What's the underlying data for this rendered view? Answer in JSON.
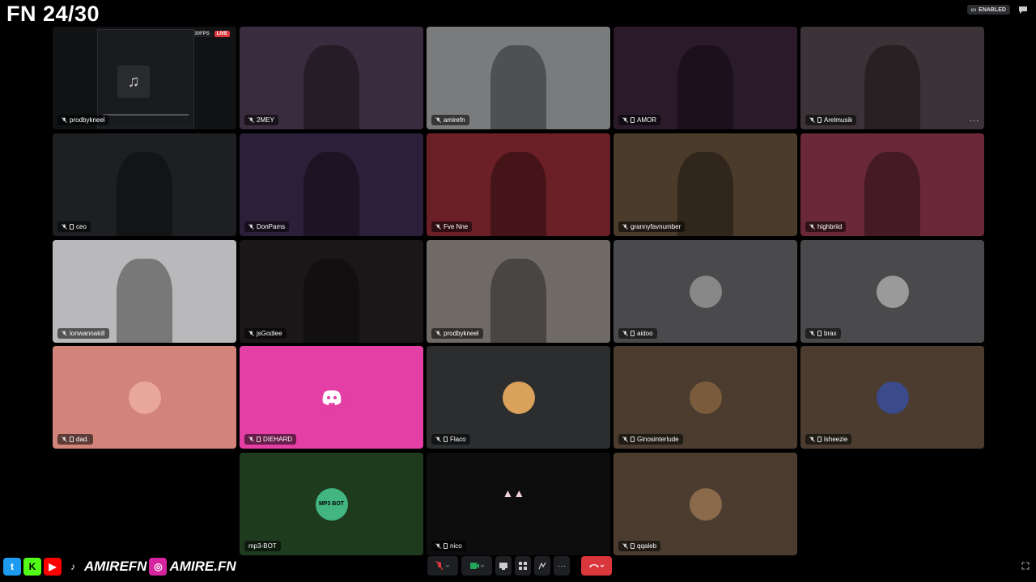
{
  "overlay": {
    "title": "FN 24/30"
  },
  "topbar": {
    "enabled_label": "ENABLED"
  },
  "stream": {
    "resolution": "720P 30FPS",
    "live": "LIVE"
  },
  "participants": [
    {
      "name": "prodbykneel",
      "kind": "stream",
      "bg": "#111214"
    },
    {
      "name": "2MEY",
      "kind": "video",
      "bg": "#3a2c3e"
    },
    {
      "name": "amirefn",
      "kind": "video",
      "bg": "#7a7b7d"
    },
    {
      "name": "AMOR",
      "kind": "video",
      "bg": "#2a1a2a"
    },
    {
      "name": "Arelmusik",
      "kind": "video",
      "bg": "#3c3338"
    },
    {
      "name": "ceo",
      "kind": "video",
      "bg": "#1e1f22"
    },
    {
      "name": "DonPams",
      "kind": "video",
      "bg": "#2b1f3a"
    },
    {
      "name": "Fve Nne",
      "kind": "video",
      "bg": "#6b1f26"
    },
    {
      "name": "grannyfavnumber",
      "kind": "video",
      "bg": "#4a3b2a"
    },
    {
      "name": "highbriid",
      "kind": "video",
      "bg": "#6a2838"
    },
    {
      "name": "lonwannakill",
      "kind": "video",
      "bg": "#b9b9bb"
    },
    {
      "name": "jsGodiee",
      "kind": "video",
      "bg": "#1b1718"
    },
    {
      "name": "prodbykneel",
      "kind": "video",
      "bg": "#6f6a66"
    },
    {
      "name": "aidoo",
      "kind": "avatar",
      "bg": "#4a4a4c",
      "avatar_color": "#888888"
    },
    {
      "name": "brax",
      "kind": "avatar",
      "bg": "#4a4a4c",
      "avatar_color": "#9a9a9a"
    },
    {
      "name": "dad.",
      "kind": "avatar",
      "bg": "#d2837a",
      "avatar_color": "#e9a79c"
    },
    {
      "name": "DIEHARD",
      "kind": "discord",
      "bg": "#e43fa4",
      "avatar_color": "#e43fa4"
    },
    {
      "name": "Flaco",
      "kind": "avatar",
      "bg": "#2c2d2f",
      "avatar_color": "#d9a15a"
    },
    {
      "name": "Ginosinterlude",
      "kind": "avatar",
      "bg": "#4b3c2f",
      "avatar_color": "#7a5c3c"
    },
    {
      "name": "lsheezie",
      "kind": "avatar",
      "bg": "#4b3c2f",
      "avatar_color": "#3b4a8a"
    },
    {
      "name": "mp3-BOT",
      "kind": "bot",
      "bg": "#1e3b1e",
      "avatar_color": "#43b581",
      "avatar_text": "MP3 BOT"
    },
    {
      "name": "nico",
      "kind": "avatar",
      "bg": "#0d0d0d",
      "avatar_color": "#0d0d0d"
    },
    {
      "name": "qqaleb",
      "kind": "avatar",
      "bg": "#4b3c2f",
      "avatar_color": "#8a6a4a"
    }
  ],
  "socials": {
    "handle1": "AMIREFN",
    "handle2": "AMIRE.FN"
  },
  "colors": {
    "leave": "#da373c",
    "camera_on": "#23a55a",
    "muted": "#da373c"
  }
}
